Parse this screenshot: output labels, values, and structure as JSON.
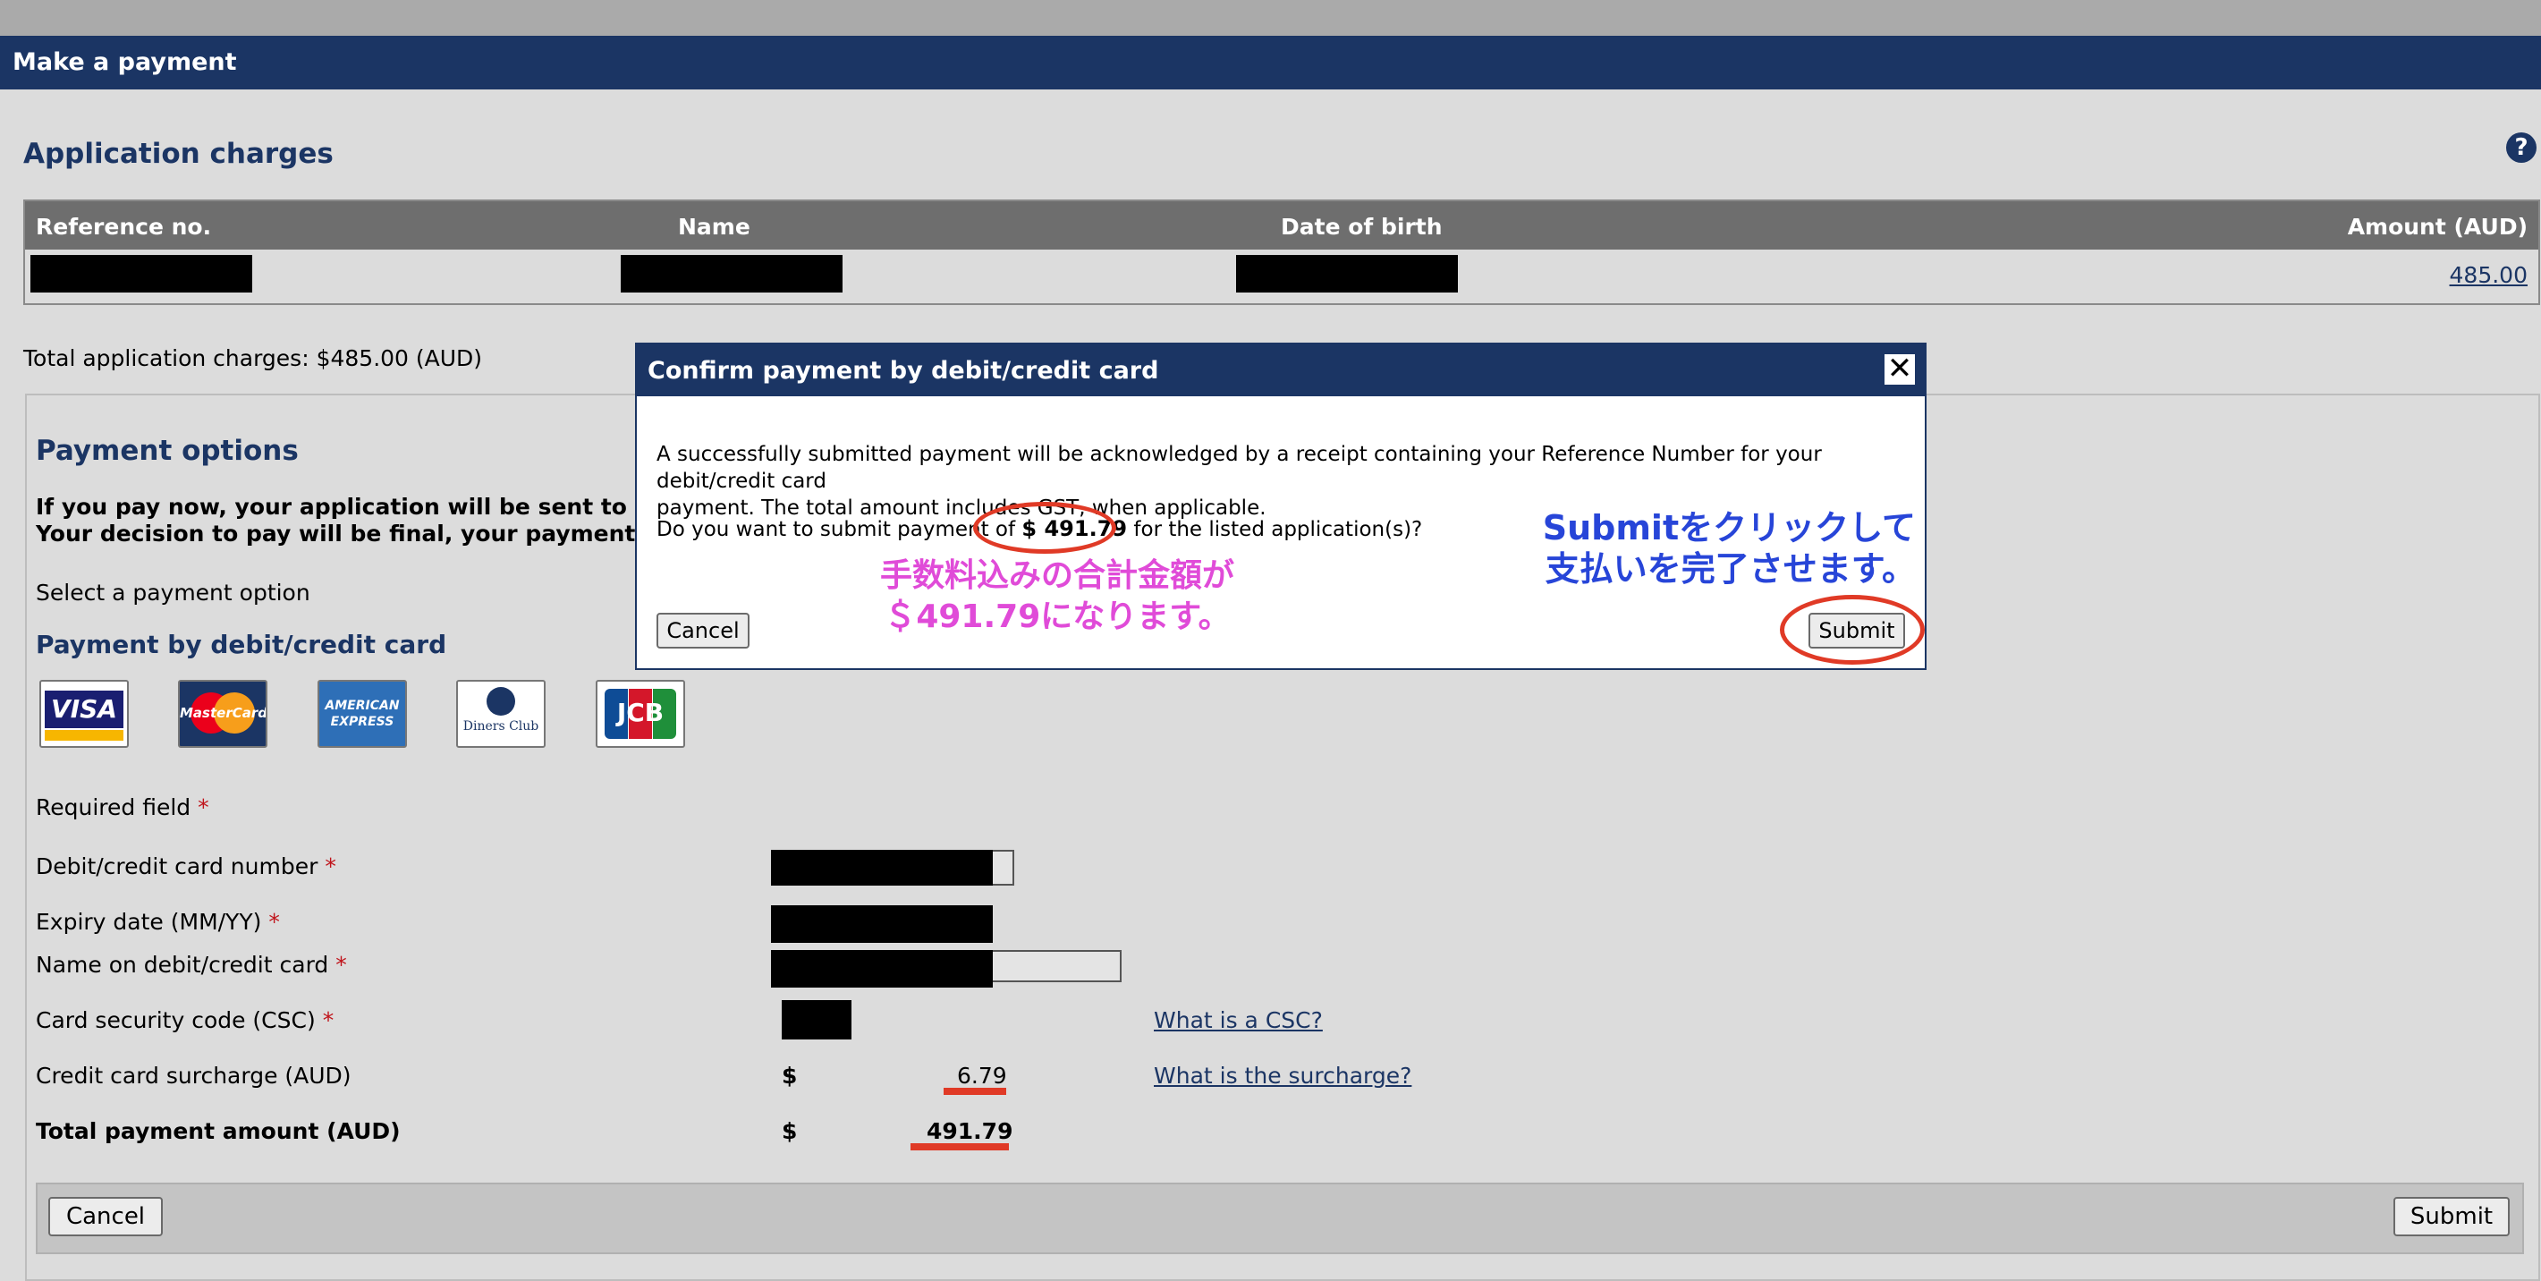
{
  "window": {
    "title": "Make a payment"
  },
  "help_icon": "question-icon",
  "application_charges": {
    "heading": "Application charges",
    "columns": [
      "Reference no.",
      "Name",
      "Date of birth",
      "Amount (AUD)"
    ],
    "rows": [
      {
        "amount": "485.00"
      }
    ],
    "total_text": "Total application charges: $485.00 (AUD)"
  },
  "payment_options": {
    "heading": "Payment options",
    "notice_line1": "If you pay now, your application will be sent to the Aust",
    "notice_line2": "Your decision to pay will be final, your payment cannot",
    "select_label": "Select a payment option",
    "card_section_heading": "Payment by debit/credit card",
    "card_logos": [
      {
        "name": "visa-logo",
        "text": "VISA",
        "bg": "#ffffff",
        "color": "#1a1f71"
      },
      {
        "name": "mastercard-logo",
        "text": "MasterCard",
        "bg": "#1b3564",
        "color": "#ffffff"
      },
      {
        "name": "amex-logo",
        "text": "AMERICAN EXPRESS",
        "bg": "#2e6fb7",
        "color": "#ffffff"
      },
      {
        "name": "diners-club-logo",
        "text": "Diners Club",
        "bg": "#ffffff",
        "color": "#1b3564"
      },
      {
        "name": "jcb-logo",
        "text": "JCB",
        "bg": "#ffffff",
        "color": "#ffffff"
      }
    ],
    "required_label": "Required field",
    "required_marker": "*",
    "fields": {
      "card_number": "Debit/credit card number",
      "expiry": "Expiry date (MM/YY)",
      "name_on_card": "Name on debit/credit card",
      "csc": "Card security code (CSC)"
    },
    "csc_link": "What is a CSC?",
    "surcharge_label": "Credit card surcharge (AUD)",
    "surcharge_currency": "$",
    "surcharge_value": "6.79",
    "surcharge_link": "What is the surcharge?",
    "total_label": "Total payment amount (AUD)",
    "total_currency": "$",
    "total_value": "491.79",
    "cancel_label": "Cancel",
    "submit_label": "Submit"
  },
  "modal": {
    "title": "Confirm payment by debit/credit card",
    "close_icon": "close-icon",
    "message_line1": "A successfully submitted payment will be acknowledged by a receipt containing your Reference Number for your debit/credit card",
    "message_line2": "payment. The total amount includes GST, when applicable.",
    "question_prefix": "Do you want to submit payment of ",
    "question_amount": "$ 491.79",
    "question_suffix": " for the listed application(s)?",
    "cancel_label": "Cancel",
    "submit_label": "Submit"
  },
  "annotations": {
    "pink_line1": "手数料込みの合計金額が",
    "pink_line2": "＄491.79になります。",
    "blue_line1": "Submitをクリックして",
    "blue_line2": "支払いを完了させます。",
    "pink_color": "#e04bd8",
    "blue_color": "#2745d8",
    "highlight_color": "#e03a26"
  },
  "colors": {
    "header_bg": "#1b3564",
    "table_header_bg": "#6e6e6e",
    "page_bg": "#dcdcdc",
    "required_red": "#c0141b"
  }
}
